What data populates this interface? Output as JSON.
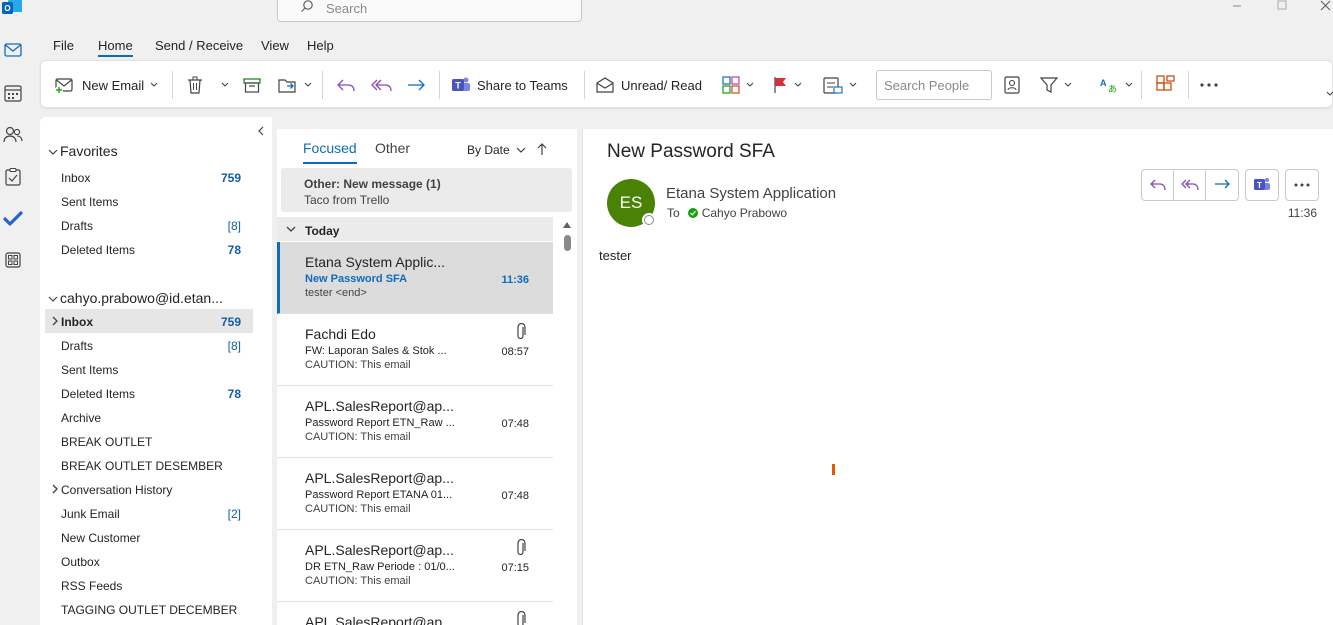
{
  "titlebar": {
    "search_placeholder": "Search"
  },
  "menu": {
    "tabs": [
      {
        "label": "File"
      },
      {
        "label": "Home"
      },
      {
        "label": "Send / Receive"
      },
      {
        "label": "View"
      },
      {
        "label": "Help"
      }
    ],
    "active": "Home"
  },
  "ribbon": {
    "new_email": "New Email",
    "share_to_teams": "Share to Teams",
    "unread_read": "Unread/ Read",
    "search_people_placeholder": "Search People"
  },
  "folders": {
    "favorites_label": "Favorites",
    "favorites": [
      {
        "name": "Inbox",
        "count": "759"
      },
      {
        "name": "Sent Items",
        "count": ""
      },
      {
        "name": "Drafts",
        "count": "[8]"
      },
      {
        "name": "Deleted Items",
        "count": "78"
      }
    ],
    "account_label": "cahyo.prabowo@id.etan...",
    "account_items": [
      {
        "name": "Inbox",
        "count": "759"
      },
      {
        "name": "Drafts",
        "count": "[8]"
      },
      {
        "name": "Sent Items",
        "count": ""
      },
      {
        "name": "Deleted Items",
        "count": "78"
      },
      {
        "name": "Archive",
        "count": ""
      },
      {
        "name": "BREAK OUTLET",
        "count": ""
      },
      {
        "name": "BREAK OUTLET DESEMBER",
        "count": ""
      },
      {
        "name": "Conversation History",
        "count": ""
      },
      {
        "name": "Junk Email",
        "count": "[2]"
      },
      {
        "name": "New Customer",
        "count": ""
      },
      {
        "name": "Outbox",
        "count": ""
      },
      {
        "name": "RSS Feeds",
        "count": ""
      },
      {
        "name": "TAGGING OUTLET DECEMBER",
        "count": ""
      }
    ]
  },
  "list": {
    "tab_focused": "Focused",
    "tab_other": "Other",
    "sort_label": "By Date",
    "other_banner_title": "Other: New message (1)",
    "other_banner_sub": "Taco from Trello",
    "today_label": "Today",
    "messages": [
      {
        "from": "Etana System Applic...",
        "subject": "New Password SFA",
        "preview": "tester <end>",
        "time": "11:36"
      },
      {
        "from": "Fachdi Edo",
        "subject": "FW: Laporan Sales & Stok ...",
        "preview": "CAUTION: This email",
        "time": "08:57"
      },
      {
        "from": "APL.SalesReport@ap...",
        "subject": "Password Report ETN_Raw ...",
        "preview": "CAUTION: This email",
        "time": "07:48"
      },
      {
        "from": "APL.SalesReport@ap...",
        "subject": "Password Report ETANA 01...",
        "preview": "CAUTION: This email",
        "time": "07:48"
      },
      {
        "from": "APL.SalesReport@ap...",
        "subject": "DR ETN_Raw Periode : 01/0...",
        "preview": "CAUTION: This email",
        "time": "07:15"
      },
      {
        "from": "APL.SalesReport@ap...",
        "subject": "",
        "preview": "",
        "time": ""
      }
    ]
  },
  "reading": {
    "subject": "New Password SFA",
    "avatar_initials": "ES",
    "sender": "Etana System Application",
    "to_label": "To",
    "recipient": "Cahyo Prabowo",
    "time": "11:36",
    "body": "tester"
  },
  "colors": {
    "accent": "#0f6cbd",
    "avatar": "#498205",
    "flag": "#d13438",
    "teams": "#4b53bc"
  }
}
